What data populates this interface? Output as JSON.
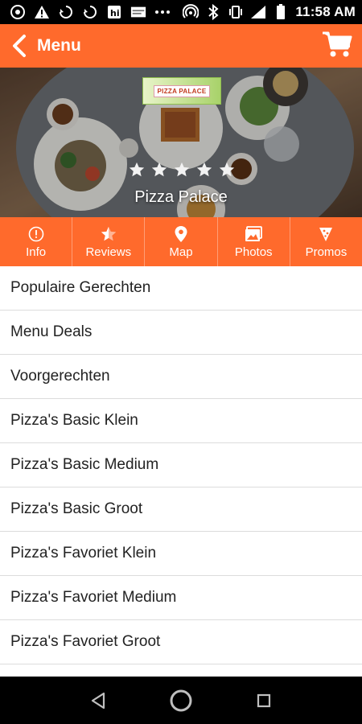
{
  "status_bar": {
    "time": "11:58 AM",
    "left_icons": [
      "chrome-icon",
      "warning-icon",
      "recycle-icon",
      "recycle-icon",
      "hi-app-icon",
      "news-app-icon",
      "more-dots-icon"
    ],
    "right_icons": [
      "hotspot-icon",
      "bluetooth-icon",
      "vibrate-icon",
      "signal-icon",
      "battery-icon"
    ]
  },
  "app_bar": {
    "title": "Menu",
    "back_icon": "chevron-left-icon",
    "cart_icon": "cart-icon",
    "color": "#ff6a2c"
  },
  "hero": {
    "restaurant_name": "Pizza Palace",
    "rating_stars": 5,
    "logo_text": "PIZZA PALACE"
  },
  "tabs": [
    {
      "label": "Info",
      "icon": "info-icon"
    },
    {
      "label": "Reviews",
      "icon": "reviews-star-icon"
    },
    {
      "label": "Map",
      "icon": "map-pin-icon"
    },
    {
      "label": "Photos",
      "icon": "photos-icon"
    },
    {
      "label": "Promos",
      "icon": "promo-tag-icon"
    }
  ],
  "menu_items": [
    "Populaire Gerechten",
    "Menu Deals",
    "Voorgerechten",
    "Pizza's Basic Klein",
    "Pizza's Basic Medium",
    "Pizza's Basic Groot",
    "Pizza's Favoriet Klein",
    "Pizza's Favoriet Medium",
    "Pizza's Favoriet Groot"
  ],
  "nav_bar": {
    "buttons": [
      "back-triangle-icon",
      "home-circle-icon",
      "recents-square-icon"
    ]
  }
}
